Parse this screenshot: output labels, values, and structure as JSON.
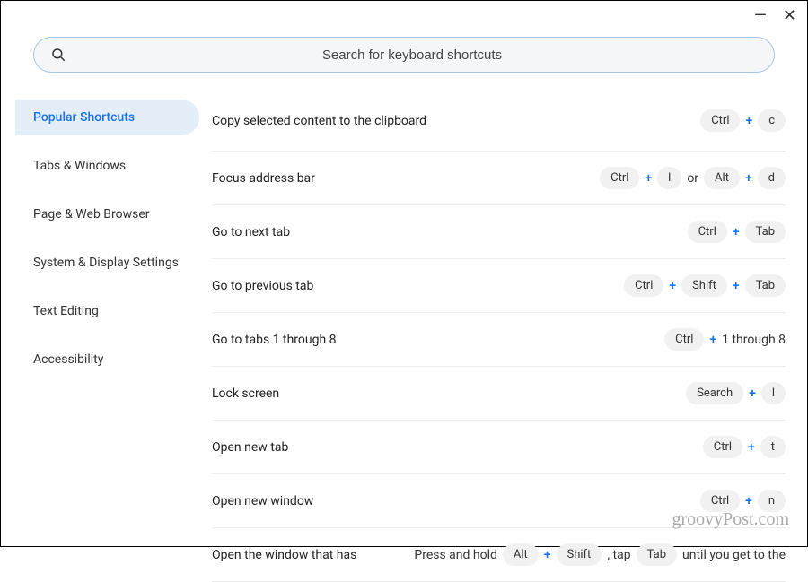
{
  "window": {
    "minimize": "—",
    "close": "✕"
  },
  "search": {
    "placeholder": "Search for keyboard shortcuts"
  },
  "sidebar": {
    "items": [
      {
        "label": "Popular Shortcuts",
        "selected": true
      },
      {
        "label": "Tabs & Windows",
        "selected": false
      },
      {
        "label": "Page & Web Browser",
        "selected": false
      },
      {
        "label": "System & Display Settings",
        "selected": false
      },
      {
        "label": "Text Editing",
        "selected": false
      },
      {
        "label": "Accessibility",
        "selected": false
      }
    ]
  },
  "rows": [
    {
      "desc": "Copy selected content to the clipboard",
      "parts": [
        {
          "t": "key",
          "v": "Ctrl"
        },
        {
          "t": "plus",
          "v": "+"
        },
        {
          "t": "key",
          "v": "c"
        }
      ]
    },
    {
      "desc": "Focus address bar",
      "parts": [
        {
          "t": "key",
          "v": "Ctrl"
        },
        {
          "t": "plus",
          "v": "+"
        },
        {
          "t": "key",
          "v": "l"
        },
        {
          "t": "plain",
          "v": "or"
        },
        {
          "t": "key",
          "v": "Alt"
        },
        {
          "t": "plus",
          "v": "+"
        },
        {
          "t": "key",
          "v": "d"
        }
      ]
    },
    {
      "desc": "Go to next tab",
      "parts": [
        {
          "t": "key",
          "v": "Ctrl"
        },
        {
          "t": "plus",
          "v": "+"
        },
        {
          "t": "key",
          "v": "Tab"
        }
      ]
    },
    {
      "desc": "Go to previous tab",
      "parts": [
        {
          "t": "key",
          "v": "Ctrl"
        },
        {
          "t": "plus",
          "v": "+"
        },
        {
          "t": "key",
          "v": "Shift"
        },
        {
          "t": "plus",
          "v": "+"
        },
        {
          "t": "key",
          "v": "Tab"
        }
      ]
    },
    {
      "desc": "Go to tabs 1 through 8",
      "parts": [
        {
          "t": "key",
          "v": "Ctrl"
        },
        {
          "t": "plus",
          "v": "+"
        },
        {
          "t": "plain",
          "v": "1 through 8"
        }
      ]
    },
    {
      "desc": "Lock screen",
      "parts": [
        {
          "t": "key",
          "v": "Search"
        },
        {
          "t": "plus",
          "v": "+"
        },
        {
          "t": "key",
          "v": "l"
        }
      ]
    },
    {
      "desc": "Open new tab",
      "parts": [
        {
          "t": "key",
          "v": "Ctrl"
        },
        {
          "t": "plus",
          "v": "+"
        },
        {
          "t": "key",
          "v": "t"
        }
      ]
    },
    {
      "desc": "Open new window",
      "parts": [
        {
          "t": "key",
          "v": "Ctrl"
        },
        {
          "t": "plus",
          "v": "+"
        },
        {
          "t": "key",
          "v": "n"
        }
      ]
    },
    {
      "desc": "Open the window that has",
      "parts": [
        {
          "t": "plain",
          "v": "Press and hold"
        },
        {
          "t": "key",
          "v": "Alt"
        },
        {
          "t": "plus",
          "v": "+"
        },
        {
          "t": "key",
          "v": "Shift"
        },
        {
          "t": "plain",
          "v": ", tap"
        },
        {
          "t": "key",
          "v": "Tab"
        },
        {
          "t": "plain",
          "v": "until you get to the"
        }
      ]
    }
  ],
  "watermark": "groovyPost.com"
}
